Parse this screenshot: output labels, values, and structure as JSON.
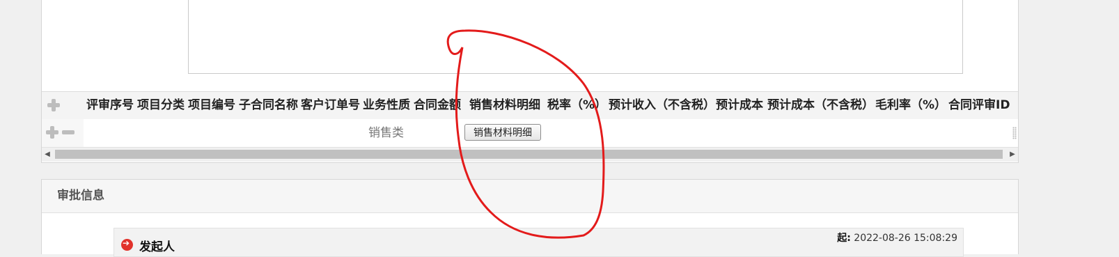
{
  "grid": {
    "columns": [
      "评审序号",
      "项目分类",
      "项目编号",
      "子合同名称",
      "客户订单号",
      "业务性质",
      "合同金额",
      "销售材料明细",
      "税率（%）",
      "预计收入（不含税）",
      "预计成本",
      "预计成本（不含税）",
      "毛利率（%）",
      "合同评审ID"
    ],
    "row": {
      "business_type": "销售类",
      "detail_button_label": "销售材料明细"
    }
  },
  "approval": {
    "title": "审批信息",
    "initiator_label": "发起人",
    "start_label": "起:",
    "start_time": "2022-08-26 15:08:29"
  },
  "colors": {
    "annotation_stroke": "#e31b1b",
    "icon_red": "#e1322b"
  }
}
